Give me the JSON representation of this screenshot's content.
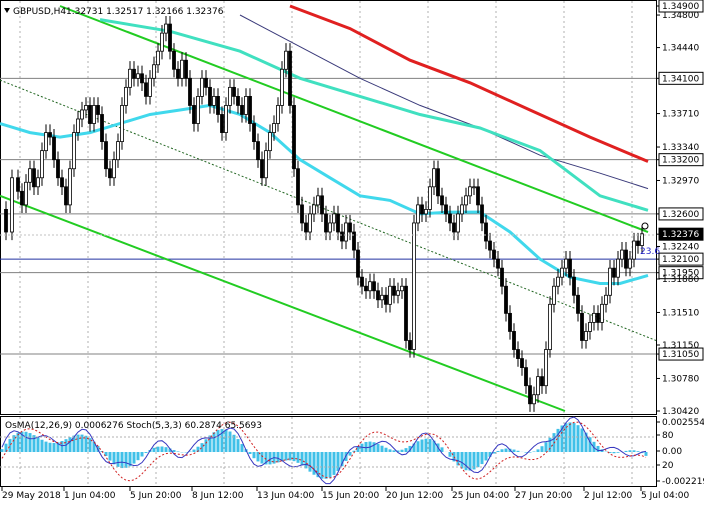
{
  "header": {
    "symbol": "GBPUSD,H4",
    "ohlc": "1.32731 1.32517 1.32166 1.32376"
  },
  "price_axis": {
    "labels": [
      "1.34900",
      "1.34800",
      "1.34440",
      "1.34100",
      "1.33710",
      "1.33340",
      "1.33200",
      "1.32970",
      "1.32600",
      "1.32376",
      "1.32240",
      "1.32100",
      "1.31950",
      "1.31880",
      "1.31510",
      "1.31150",
      "1.31050",
      "1.30780",
      "1.30420"
    ],
    "boxed": [
      "1.34900",
      "1.34100",
      "1.33200",
      "1.32600",
      "1.32376",
      "1.32100",
      "1.31950",
      "1.31050"
    ],
    "current": "1.32376",
    "fib_label": "23.6"
  },
  "time_axis": {
    "labels": [
      "29 May 2018",
      "1 Jun 04:00",
      "5 Jun 20:00",
      "8 Jun 12:00",
      "13 Jun 04:00",
      "15 Jun 20:00",
      "20 Jun 12:00",
      "25 Jun 04:00",
      "27 Jun 20:00",
      "2 Jul 12:00",
      "5 Jul 04:00"
    ]
  },
  "indicator": {
    "label": "OsMA(12,26,9) 0.0006276 Stoch(5,3,3) 60.2874 65.5693",
    "axis_labels": [
      "0.002554",
      "80",
      "0.00",
      "20",
      "-0.002219"
    ]
  },
  "chart_data": {
    "type": "candlestick",
    "instrument": "GBPUSD",
    "timeframe": "H4",
    "ylim": [
      1.3042,
      1.349
    ],
    "last_price": 1.32376,
    "horizontal_levels": [
      1.341,
      1.332,
      1.326,
      1.321,
      1.3195,
      1.3105
    ],
    "close_path": [
      [
        0,
        1.3265
      ],
      [
        6,
        1.324
      ],
      [
        12,
        1.33
      ],
      [
        18,
        1.3285
      ],
      [
        22,
        1.327
      ],
      [
        26,
        1.3295
      ],
      [
        30,
        1.331
      ],
      [
        34,
        1.329
      ],
      [
        38,
        1.33
      ],
      [
        42,
        1.333
      ],
      [
        46,
        1.335
      ],
      [
        50,
        1.3345
      ],
      [
        54,
        1.332
      ],
      [
        58,
        1.33
      ],
      [
        62,
        1.329
      ],
      [
        66,
        1.327
      ],
      [
        70,
        1.331
      ],
      [
        74,
        1.335
      ],
      [
        78,
        1.3365
      ],
      [
        82,
        1.3375
      ],
      [
        86,
        1.338
      ],
      [
        90,
        1.336
      ],
      [
        94,
        1.338
      ],
      [
        98,
        1.337
      ],
      [
        102,
        1.334
      ],
      [
        106,
        1.331
      ],
      [
        110,
        1.33
      ],
      [
        114,
        1.332
      ],
      [
        118,
        1.334
      ],
      [
        122,
        1.338
      ],
      [
        126,
        1.34
      ],
      [
        130,
        1.342
      ],
      [
        134,
        1.341
      ],
      [
        138,
        1.3415
      ],
      [
        142,
        1.3405
      ],
      [
        146,
        1.339
      ],
      [
        150,
        1.341
      ],
      [
        154,
        1.3425
      ],
      [
        158,
        1.344
      ],
      [
        162,
        1.346
      ],
      [
        166,
        1.347
      ],
      [
        170,
        1.344
      ],
      [
        174,
        1.342
      ],
      [
        178,
        1.341
      ],
      [
        182,
        1.343
      ],
      [
        186,
        1.341
      ],
      [
        190,
        1.338
      ],
      [
        194,
        1.336
      ],
      [
        198,
        1.339
      ],
      [
        202,
        1.341
      ],
      [
        206,
        1.34
      ],
      [
        210,
        1.338
      ],
      [
        214,
        1.339
      ],
      [
        218,
        1.337
      ],
      [
        222,
        1.335
      ],
      [
        226,
        1.338
      ],
      [
        230,
        1.34
      ],
      [
        234,
        1.339
      ],
      [
        238,
        1.338
      ],
      [
        242,
        1.337
      ],
      [
        246,
        1.339
      ],
      [
        250,
        1.336
      ],
      [
        254,
        1.334
      ],
      [
        258,
        1.332
      ],
      [
        262,
        1.33
      ],
      [
        266,
        1.333
      ],
      [
        270,
        1.335
      ],
      [
        274,
        1.336
      ],
      [
        278,
        1.338
      ],
      [
        282,
        1.342
      ],
      [
        286,
        1.344
      ],
      [
        290,
        1.338
      ],
      [
        294,
        1.331
      ],
      [
        298,
        1.327
      ],
      [
        302,
        1.325
      ],
      [
        306,
        1.324
      ],
      [
        310,
        1.326
      ],
      [
        314,
        1.327
      ],
      [
        318,
        1.328
      ],
      [
        322,
        1.326
      ],
      [
        326,
        1.324
      ],
      [
        330,
        1.325
      ],
      [
        334,
        1.326
      ],
      [
        338,
        1.324
      ],
      [
        342,
        1.323
      ],
      [
        346,
        1.325
      ],
      [
        350,
        1.324
      ],
      [
        354,
        1.322
      ],
      [
        358,
        1.319
      ],
      [
        362,
        1.318
      ],
      [
        366,
        1.3175
      ],
      [
        370,
        1.3185
      ],
      [
        374,
        1.3175
      ],
      [
        378,
        1.3165
      ],
      [
        382,
        1.317
      ],
      [
        386,
        1.316
      ],
      [
        390,
        1.318
      ],
      [
        394,
        1.317
      ],
      [
        398,
        1.3175
      ],
      [
        402,
        1.318
      ],
      [
        406,
        1.312
      ],
      [
        410,
        1.311
      ],
      [
        414,
        1.325
      ],
      [
        418,
        1.327
      ],
      [
        422,
        1.326
      ],
      [
        426,
        1.3265
      ],
      [
        430,
        1.329
      ],
      [
        434,
        1.331
      ],
      [
        438,
        1.328
      ],
      [
        442,
        1.327
      ],
      [
        446,
        1.326
      ],
      [
        450,
        1.325
      ],
      [
        454,
        1.324
      ],
      [
        458,
        1.326
      ],
      [
        462,
        1.327
      ],
      [
        466,
        1.328
      ],
      [
        470,
        1.329
      ],
      [
        474,
        1.329
      ],
      [
        478,
        1.327
      ],
      [
        482,
        1.325
      ],
      [
        486,
        1.323
      ],
      [
        490,
        1.322
      ],
      [
        494,
        1.321
      ],
      [
        498,
        1.32
      ],
      [
        502,
        1.318
      ],
      [
        506,
        1.315
      ],
      [
        510,
        1.313
      ],
      [
        514,
        1.311
      ],
      [
        518,
        1.31
      ],
      [
        522,
        1.309
      ],
      [
        526,
        1.307
      ],
      [
        530,
        1.305
      ],
      [
        534,
        1.306
      ],
      [
        538,
        1.308
      ],
      [
        542,
        1.307
      ],
      [
        546,
        1.311
      ],
      [
        550,
        1.316
      ],
      [
        554,
        1.318
      ],
      [
        558,
        1.319
      ],
      [
        562,
        1.32
      ],
      [
        566,
        1.321
      ],
      [
        570,
        1.319
      ],
      [
        574,
        1.317
      ],
      [
        578,
        1.315
      ],
      [
        582,
        1.312
      ],
      [
        586,
        1.313
      ],
      [
        590,
        1.314
      ],
      [
        594,
        1.315
      ],
      [
        598,
        1.314
      ],
      [
        602,
        1.316
      ],
      [
        606,
        1.317
      ],
      [
        610,
        1.32
      ],
      [
        614,
        1.319
      ],
      [
        618,
        1.321
      ],
      [
        622,
        1.322
      ],
      [
        626,
        1.32
      ],
      [
        630,
        1.321
      ],
      [
        634,
        1.323
      ],
      [
        638,
        1.3225
      ],
      [
        642,
        1.3238
      ]
    ],
    "moving_averages": [
      {
        "color": "#e02020",
        "points": [
          [
            290,
            1.349
          ],
          [
            350,
            1.3465
          ],
          [
            410,
            1.343
          ],
          [
            470,
            1.3405
          ],
          [
            530,
            1.3375
          ],
          [
            590,
            1.3345
          ],
          [
            648,
            1.3318
          ]
        ]
      },
      {
        "color": "#3a3a7a",
        "points": [
          [
            240,
            1.348
          ],
          [
            300,
            1.3445
          ],
          [
            360,
            1.341
          ],
          [
            420,
            1.338
          ],
          [
            480,
            1.3355
          ],
          [
            540,
            1.3325
          ],
          [
            600,
            1.3305
          ],
          [
            648,
            1.3288
          ]
        ]
      },
      {
        "color": "#40e0c0",
        "points": [
          [
            100,
            1.3475
          ],
          [
            170,
            1.3462
          ],
          [
            240,
            1.344
          ],
          [
            300,
            1.341
          ],
          [
            360,
            1.339
          ],
          [
            420,
            1.337
          ],
          [
            480,
            1.3355
          ],
          [
            540,
            1.333
          ],
          [
            600,
            1.328
          ],
          [
            648,
            1.3264
          ]
        ]
      },
      {
        "color": "#40d8ec",
        "points": [
          [
            0,
            1.336
          ],
          [
            30,
            1.335
          ],
          [
            60,
            1.3345
          ],
          [
            90,
            1.335
          ],
          [
            120,
            1.336
          ],
          [
            150,
            1.337
          ],
          [
            180,
            1.3375
          ],
          [
            210,
            1.338
          ],
          [
            240,
            1.337
          ],
          [
            270,
            1.335
          ],
          [
            300,
            1.332
          ],
          [
            330,
            1.33
          ],
          [
            360,
            1.328
          ],
          [
            390,
            1.3275
          ],
          [
            420,
            1.326
          ],
          [
            450,
            1.3262
          ],
          [
            480,
            1.3262
          ],
          [
            510,
            1.324
          ],
          [
            540,
            1.321
          ],
          [
            570,
            1.319
          ],
          [
            600,
            1.3183
          ],
          [
            620,
            1.3183
          ],
          [
            648,
            1.3192
          ]
        ]
      }
    ],
    "channel_lines": [
      {
        "style": "solid",
        "color": "#22cc22",
        "from": [
          60,
          1.349
        ],
        "to": [
          648,
          1.324
        ]
      },
      {
        "style": "dotted",
        "color": "#226622",
        "from": [
          0,
          1.3408
        ],
        "to": [
          656,
          1.312
        ]
      },
      {
        "style": "solid",
        "color": "#22cc22",
        "from": [
          0,
          1.328
        ],
        "to": [
          565,
          1.3042
        ]
      }
    ],
    "indicator_panel": {
      "osma_last": 0.0006276,
      "stoch_k": 60.2874,
      "stoch_d": 65.5693
    }
  }
}
